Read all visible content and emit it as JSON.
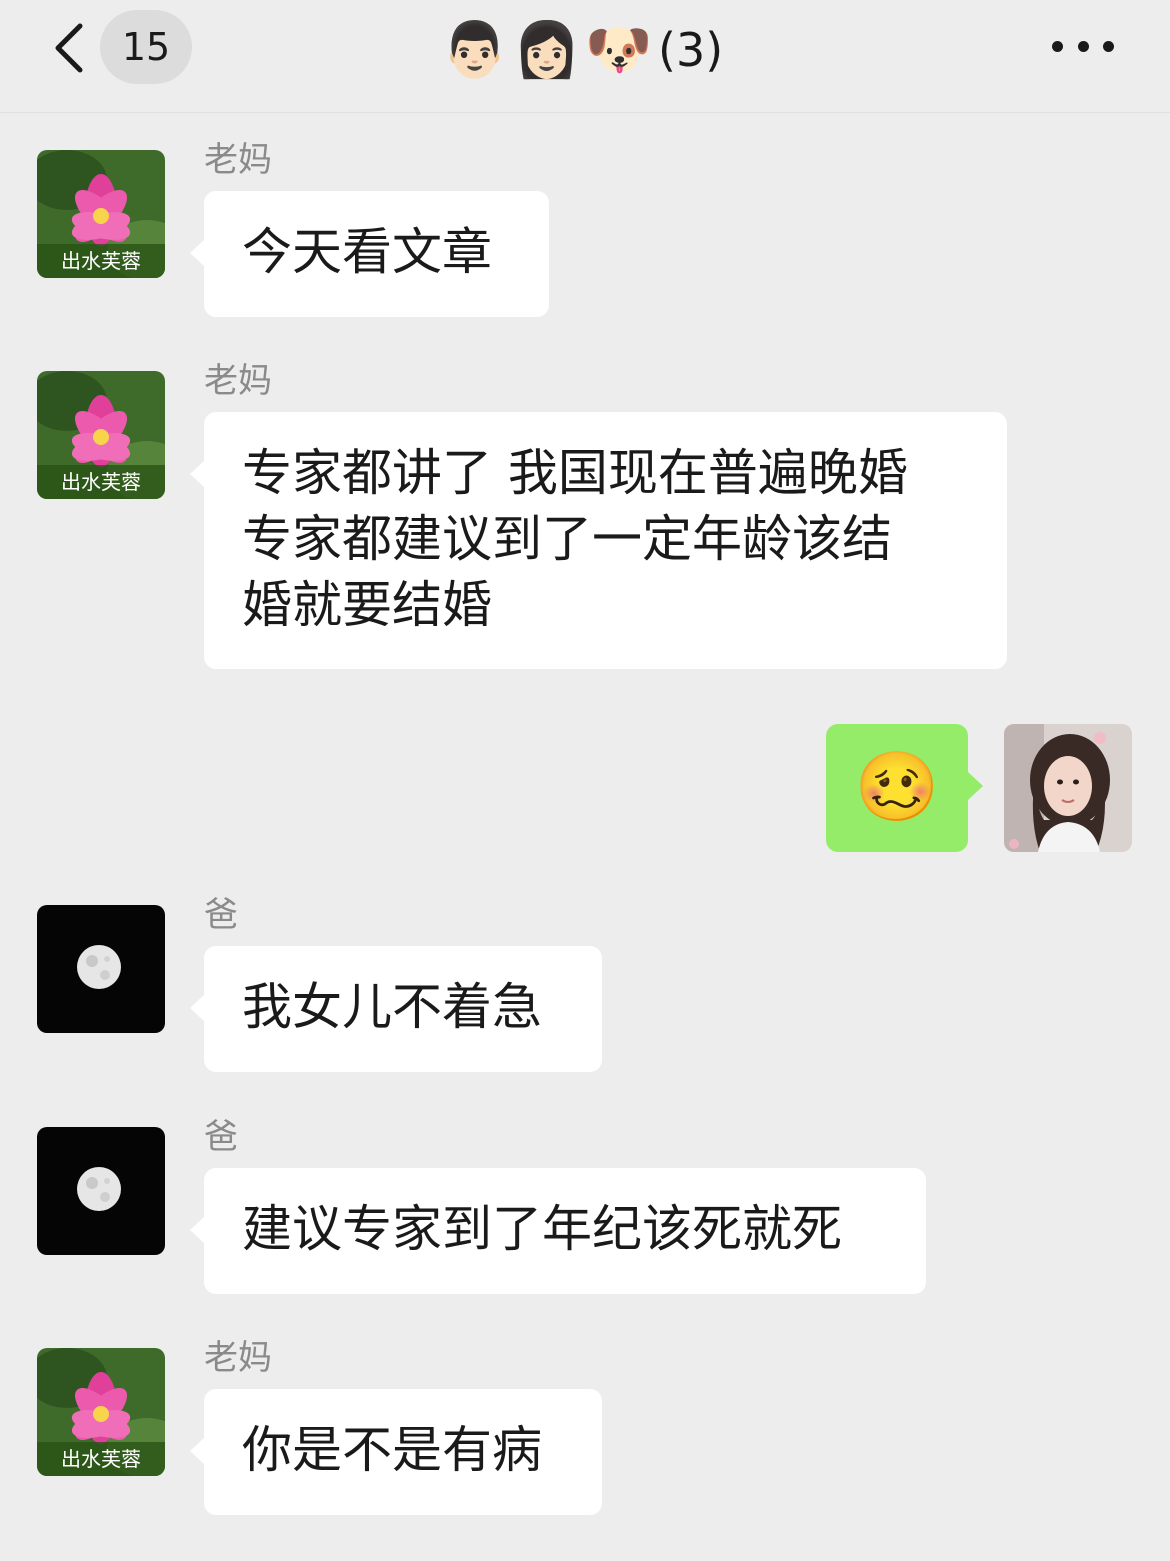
{
  "header": {
    "unread_count": "15",
    "title_emojis": [
      "👨🏻",
      "👩🏻",
      "🐶"
    ],
    "member_count": "(3)"
  },
  "messages": [
    {
      "sender": "老妈",
      "lines": [
        "今天看文章"
      ],
      "avatar": "lotus-avatar"
    },
    {
      "sender": "老妈",
      "lines": [
        "专家都讲了 我国现在普遍晚婚",
        "专家都建议到了一定年龄该结",
        "婚就要结婚"
      ],
      "avatar": "lotus-avatar"
    },
    {
      "sender": "me",
      "emoji": "🥴",
      "avatar": "girl-photo-avatar"
    },
    {
      "sender": "爸",
      "lines": [
        "我女儿不着急"
      ],
      "avatar": "moon-avatar"
    },
    {
      "sender": "爸",
      "lines": [
        "建议专家到了年纪该死就死"
      ],
      "avatar": "moon-avatar"
    },
    {
      "sender": "老妈",
      "lines": [
        "你是不是有病"
      ],
      "avatar": "lotus-avatar"
    }
  ],
  "avatar_captions": {
    "lotus": "出水芙蓉"
  },
  "colors": {
    "background": "#ededed",
    "bubble_other": "#ffffff",
    "bubble_me": "#95ec69",
    "sender_name": "#8a8a8a"
  }
}
